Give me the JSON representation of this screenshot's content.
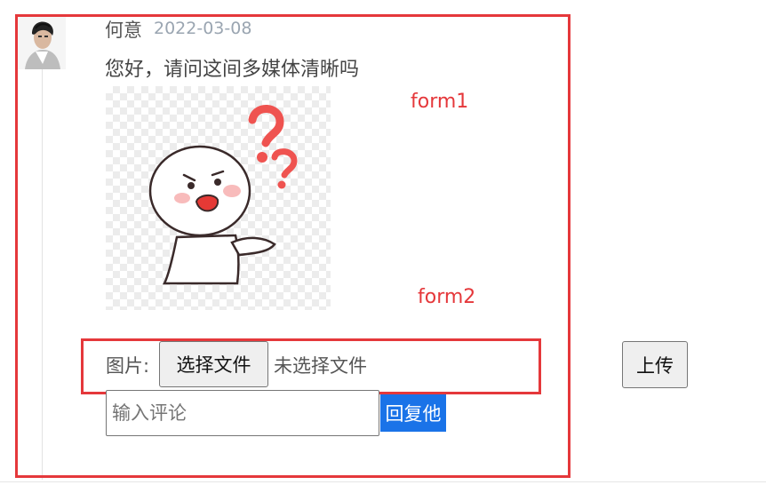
{
  "comment": {
    "username": "何意",
    "date": "2022-03-08",
    "text": "您好，请问这间多媒体清晰吗"
  },
  "annotations": {
    "form1": "form1",
    "form2": "form2",
    "color": "#e5383b"
  },
  "upload_form": {
    "image_label": "图片:",
    "file_button": "选择文件",
    "file_status": "未选择文件",
    "upload_button": "上传"
  },
  "reply_form": {
    "placeholder": "输入评论",
    "reply_button": "回复他",
    "reply_button_color": "#1a73e8"
  },
  "icons": {
    "avatar": "user-avatar",
    "sticker": "confused-sticker-image"
  }
}
